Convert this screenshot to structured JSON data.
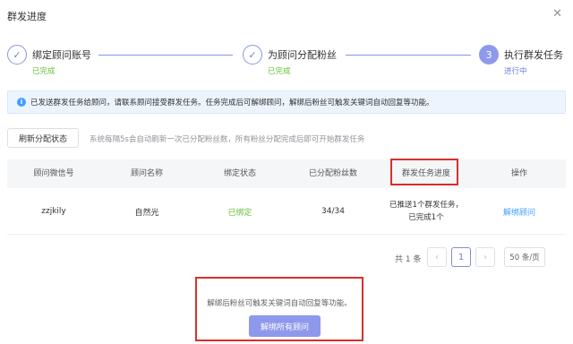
{
  "dialog": {
    "title": "群发进度",
    "close_icon": "close-icon"
  },
  "steps": [
    {
      "title": "绑定顾问账号",
      "status": "已完成",
      "icon": "check-icon"
    },
    {
      "title": "为顾问分配粉丝",
      "status": "已完成",
      "icon": "check-icon"
    },
    {
      "number": "3",
      "title": "执行群发任务",
      "status": "进行中"
    }
  ],
  "notice": {
    "icon": "info-icon",
    "text": "已发送群发任务给顾问，请联系顾问接受群发任务。任务完成后可解绑顾问，解绑后粉丝可触发关键词自动回复等功能。"
  },
  "toolbar": {
    "refresh_label": "刷新分配状态",
    "hint": "系统每隔5s会自动刷新一次已分配粉丝数，所有粉丝分配完成后即可开始群发任务"
  },
  "table": {
    "columns": [
      "顾问微信号",
      "顾问名称",
      "绑定状态",
      "已分配粉丝数",
      "群发任务进度",
      "操作"
    ],
    "rows": [
      {
        "wechat_id": "zzjkily",
        "name": "自然光",
        "bind_status": "已绑定",
        "fans": "34/34",
        "progress_line1": "已推送1个群发任务，",
        "progress_line2": "已完成1个",
        "action": "解绑顾问"
      }
    ]
  },
  "pagination": {
    "total": "共 1 条",
    "current_page": "1",
    "page_size": "50 条/页"
  },
  "footer": {
    "text": "解绑后粉丝可触发关键词自动回复等功能。",
    "unbind_all_label": "解绑所有顾问"
  },
  "colors": {
    "primary": "#8e99eb",
    "success": "#67c23a",
    "link": "#409eff",
    "highlight": "#d8302d"
  }
}
